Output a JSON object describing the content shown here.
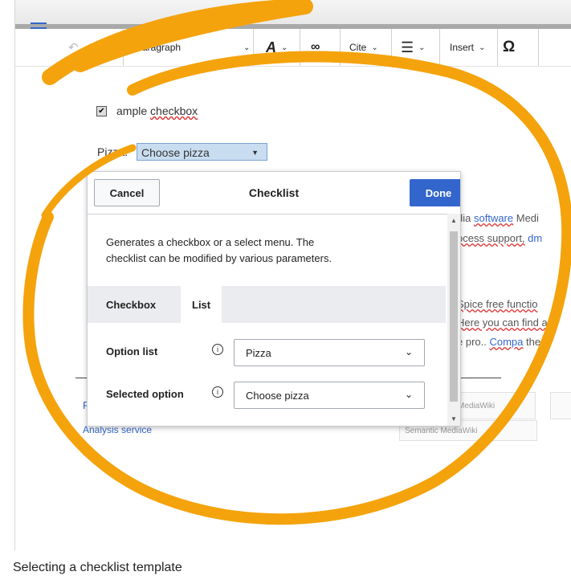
{
  "toolbar": {
    "paragraph": "Paragraph",
    "cite": "Cite",
    "insert": "Insert",
    "special_char": "Ω"
  },
  "page": {
    "checkbox_label_1": "ample",
    "checkbox_label_2": "checkbox",
    "pizza_label": "Pizza:",
    "pizza_value": "Choose pizza",
    "bg_line_1a": "dia",
    "bg_line_1b": "software",
    "bg_line_1c": "Medi",
    "bg_line_2a": "ocess support,",
    "bg_line_2b": "dm",
    "bg_line_3a": "Spice free functio",
    "bg_line_4a": "Here you can find a",
    "bg_line_5a": "e pro..",
    "bg_line_5b": "Compa",
    "bg_line_5c": "the",
    "footer_link": "Analysis service",
    "footer_left": "F",
    "logo_1": "MediaWiki",
    "logo_2": "Semantic MediaWiki"
  },
  "dialog": {
    "cancel": "Cancel",
    "title": "Checklist",
    "done": "Done",
    "description_1": "Generates a checkbox or a select menu. The",
    "description_2": "checklist can be modified by various parameters.",
    "tabs": [
      "Checkbox",
      "List"
    ],
    "option_list_label": "Option list",
    "option_list_value": "Pizza",
    "selected_option_label": "Selected option",
    "selected_option_value": "Choose pizza"
  },
  "caption": "Selecting a checklist template",
  "colors": {
    "accent": "#3366cc",
    "annotation": "#f4a30c"
  },
  "icons": {
    "menu": "hamburger-menu-icon",
    "undo": "undo-icon",
    "redo": "redo-icon",
    "text_style": "text-style-icon",
    "link": "link-icon",
    "list": "bulleted-list-icon",
    "info": "info-icon",
    "dropdown": "chevron-down-icon"
  }
}
